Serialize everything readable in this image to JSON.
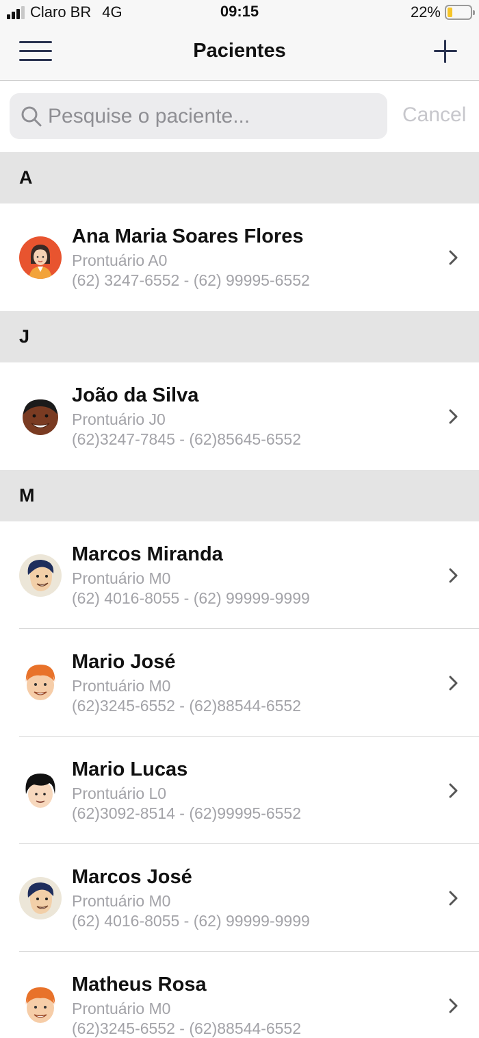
{
  "status_bar": {
    "carrier": "Claro BR",
    "network": "4G",
    "time": "09:15",
    "battery": "22%",
    "battery_level": 0.22,
    "battery_color": "#f6c529"
  },
  "nav": {
    "title": "Pacientes",
    "left_icon": "hamburger-menu-icon",
    "right_icon": "plus-icon",
    "icon_color": "#2a3350"
  },
  "search": {
    "placeholder": "Pesquise o paciente...",
    "value": "",
    "cancel_label": "Cancel"
  },
  "sections": [
    {
      "letter": "A",
      "patients": [
        {
          "name": "Ana Maria Soares Flores",
          "record": "Prontuário A0",
          "phones": "(62) 3247-6552 - (62) 99995-6552",
          "avatar": "woman-avatar-icon"
        }
      ]
    },
    {
      "letter": "J",
      "patients": [
        {
          "name": "João da Silva",
          "record": "Prontuário J0",
          "phones": "(62)3247-7845 - (62)85645-6552",
          "avatar": "man-dark-avatar-icon"
        }
      ]
    },
    {
      "letter": "M",
      "patients": [
        {
          "name": "Marcos Miranda",
          "record": "Prontuário M0",
          "phones": "(62) 4016-8055 - (62) 99999-9999",
          "avatar": "man-blue-hair-avatar-icon"
        },
        {
          "name": "Mario José",
          "record": "Prontuário M0",
          "phones": "(62)3245-6552 - (62)88544-6552",
          "avatar": "man-red-hair-avatar-icon"
        },
        {
          "name": "Mario Lucas",
          "record": "Prontuário L0",
          "phones": "(62)3092-8514 - (62)99995-6552",
          "avatar": "man-black-hair-avatar-icon"
        },
        {
          "name": "Marcos José",
          "record": "Prontuário M0",
          "phones": "(62) 4016-8055 - (62) 99999-9999",
          "avatar": "man-blue-hair-avatar-icon"
        },
        {
          "name": "Matheus Rosa",
          "record": "Prontuário M0",
          "phones": "(62)3245-6552 - (62)88544-6552",
          "avatar": "man-red-hair-avatar-icon"
        }
      ]
    }
  ]
}
